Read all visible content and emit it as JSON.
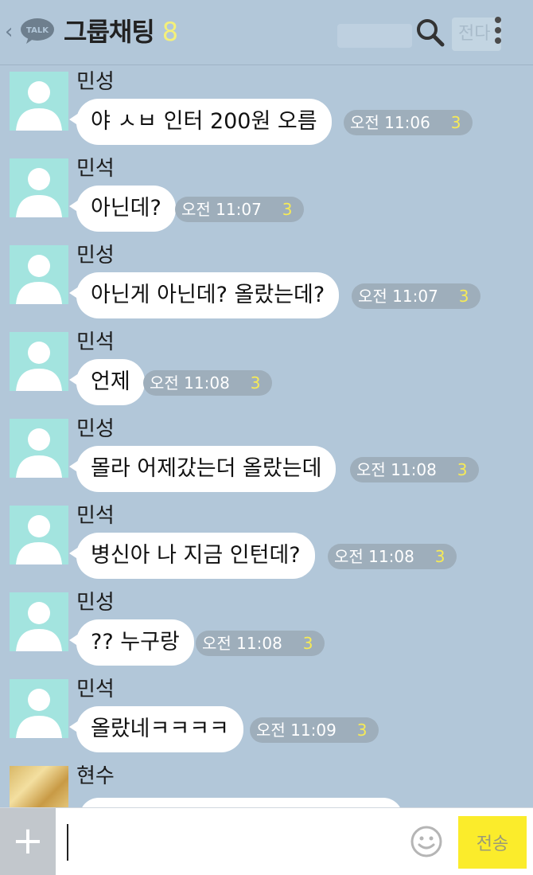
{
  "header": {
    "back_icon": "chevron-left-icon",
    "logo_text": "TALK",
    "title": "그룹채팅",
    "member_count": "8",
    "button_label": "전다",
    "search_icon": "search-icon",
    "menu_icon": "more-vertical-icon"
  },
  "messages": [
    {
      "sender": "민성",
      "text": "야 ㅅㅂ 인터 200원 오름",
      "time": "오전 11:06",
      "unread": "3"
    },
    {
      "sender": "민석",
      "text": "아닌데?",
      "time": "오전 11:07",
      "unread": "3"
    },
    {
      "sender": "민성",
      "text": "아닌게 아닌데? 올랐는데?",
      "time": "오전 11:07",
      "unread": "3"
    },
    {
      "sender": "민석",
      "text": "언제",
      "time": "오전 11:08",
      "unread": "3"
    },
    {
      "sender": "민성",
      "text": "몰라 어제갔는더 올랐는데",
      "time": "오전 11:08",
      "unread": "3"
    },
    {
      "sender": "민석",
      "text": "병신아 나 지금 인턴데?",
      "time": "오전 11:08",
      "unread": "3"
    },
    {
      "sender": "민성",
      "text": "?? 누구랑",
      "time": "오전 11:08",
      "unread": "3"
    },
    {
      "sender": "민석",
      "text": "올랐네ㅋㅋㅋㅋ",
      "time": "오전 11:09",
      "unread": "3"
    }
  ],
  "last_message": {
    "sender": "현수"
  },
  "input_bar": {
    "plus_label": "+",
    "placeholder": "",
    "emoji_icon": "smiley-icon",
    "send_label": "전송"
  },
  "colors": {
    "background": "#b2c7d9",
    "bubble": "#ffffff",
    "meta_pill": "#9eaebb",
    "unread": "#f6ea56",
    "send_button": "#fbec2b",
    "avatar": "#a3e4df"
  }
}
